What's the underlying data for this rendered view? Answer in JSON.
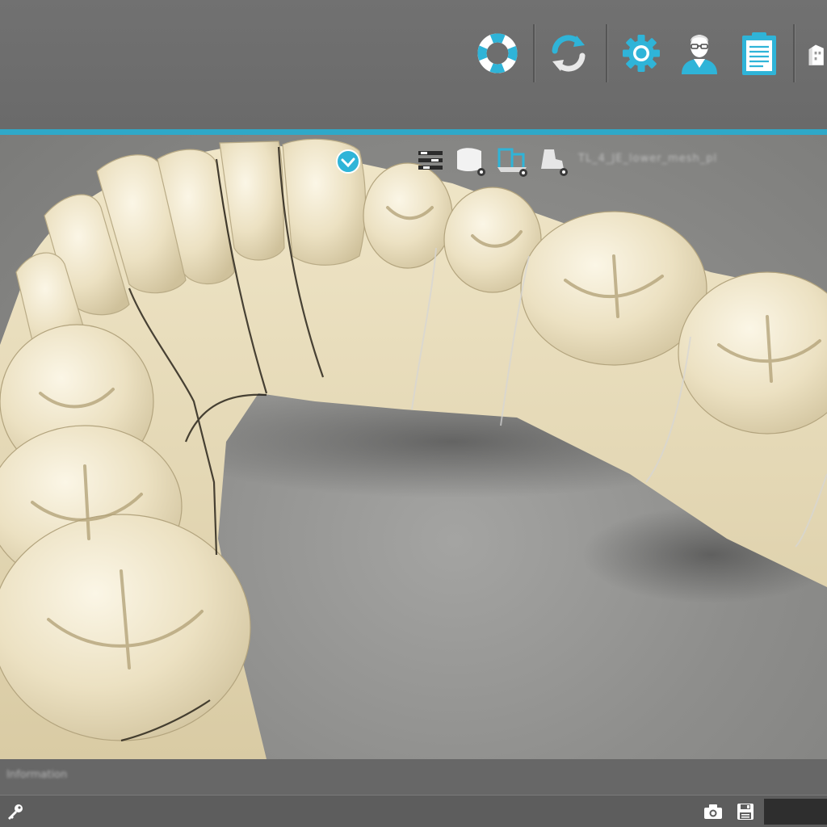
{
  "app": {
    "accent_color": "#2fa8c8"
  },
  "toolbar": {
    "buttons": [
      {
        "icon": "lifebuoy-icon",
        "tooltip": ""
      },
      {
        "icon": "sync-icon",
        "tooltip": ""
      },
      {
        "icon": "gear-icon",
        "tooltip": ""
      },
      {
        "icon": "user-avatar-icon",
        "tooltip": ""
      },
      {
        "icon": "clipboard-icon",
        "tooltip": ""
      },
      {
        "icon": "building-icon",
        "tooltip": ""
      }
    ]
  },
  "viewport": {
    "content": "3D scan of lower dental arch model (sectioned die model)",
    "overlay_icons": [
      "check-circle-icon",
      "layers-icon",
      "visibility-scan-icon",
      "visibility-die-icon",
      "visibility-antagonist-icon"
    ],
    "file_label": "TL_4_JE_lower_mesh_pl"
  },
  "info_strip": {
    "text": "Information"
  },
  "status_bar": {
    "icons": [
      "key-icon",
      "camera-icon",
      "save-icon"
    ],
    "field_value": ""
  }
}
